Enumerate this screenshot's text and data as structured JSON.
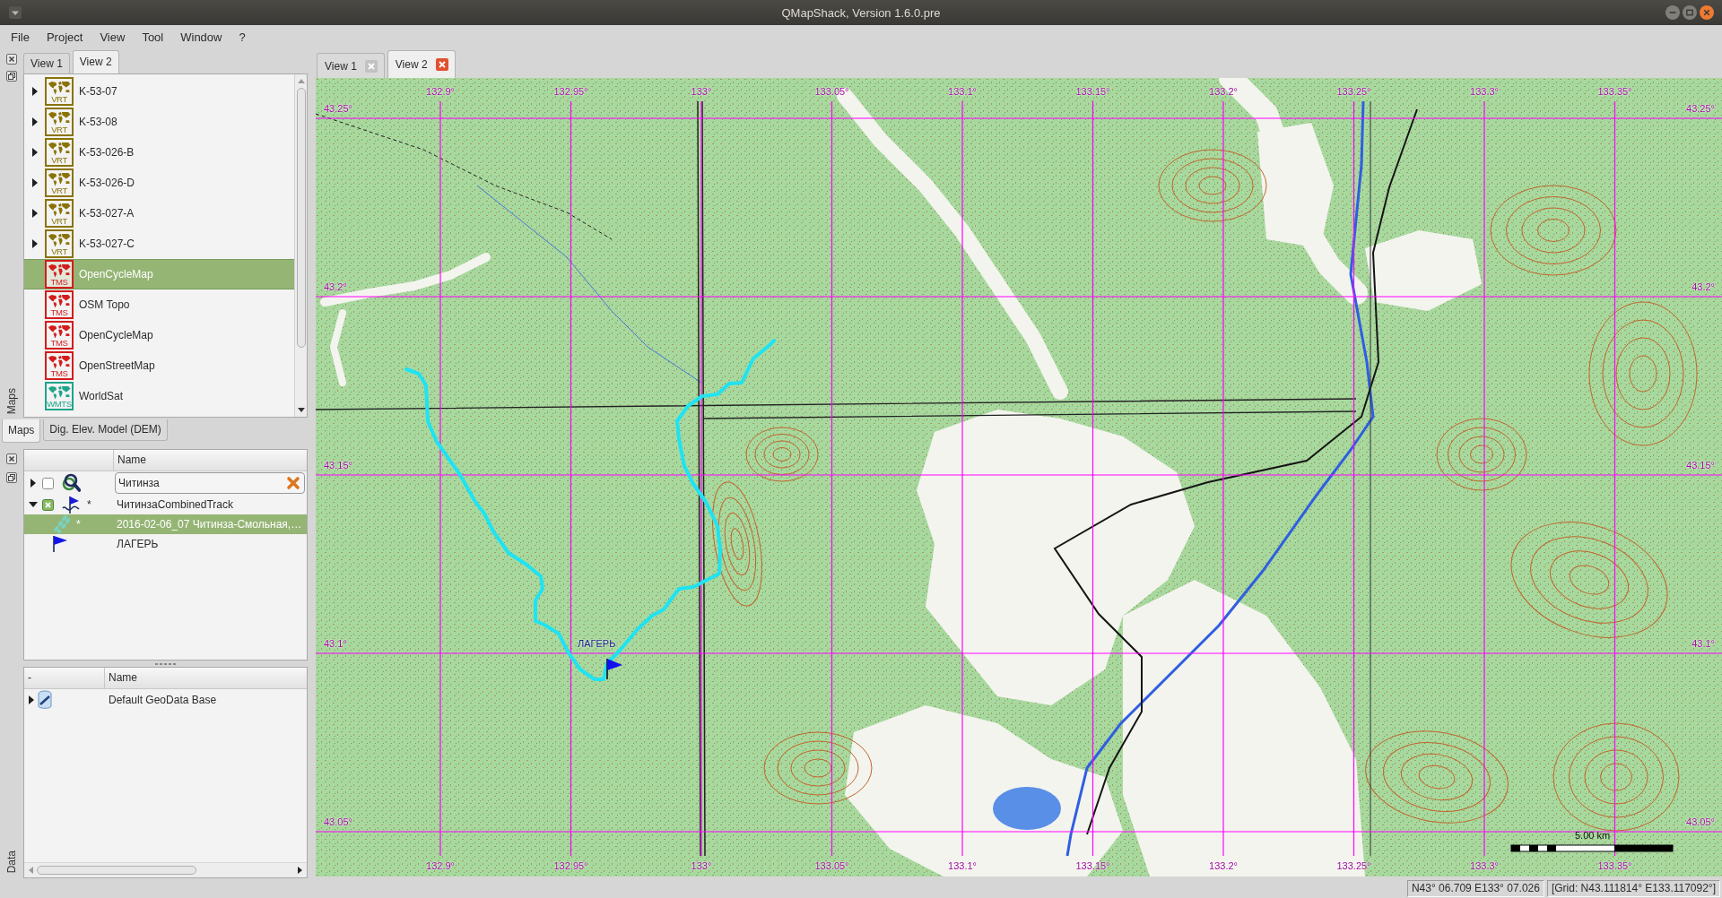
{
  "window": {
    "title": "QMapShack, Version 1.6.0.pre"
  },
  "menu": [
    "File",
    "Project",
    "View",
    "Tool",
    "Window",
    "?"
  ],
  "maps_dock": {
    "title": "Maps",
    "view_tabs": [
      {
        "label": "View 1",
        "selected": false
      },
      {
        "label": "View 2",
        "selected": true
      }
    ],
    "maps": [
      {
        "name": "K-53-07",
        "type": "VRT",
        "color": "#8a7305",
        "expandable": true,
        "selected": false
      },
      {
        "name": "K-53-08",
        "type": "VRT",
        "color": "#8a7305",
        "expandable": true,
        "selected": false
      },
      {
        "name": "K-53-026-B",
        "type": "VRT",
        "color": "#8a7305",
        "expandable": true,
        "selected": false
      },
      {
        "name": "K-53-026-D",
        "type": "VRT",
        "color": "#8a7305",
        "expandable": true,
        "selected": false
      },
      {
        "name": "K-53-027-A",
        "type": "VRT",
        "color": "#8a7305",
        "expandable": true,
        "selected": false
      },
      {
        "name": "K-53-027-C",
        "type": "VRT",
        "color": "#8a7305",
        "expandable": true,
        "selected": false
      },
      {
        "name": "OpenCycleMap",
        "type": "TMS",
        "color": "#d41c1c",
        "expandable": false,
        "selected": true
      },
      {
        "name": "OSM Topo",
        "type": "TMS",
        "color": "#d41c1c",
        "expandable": false,
        "selected": false
      },
      {
        "name": "OpenCycleMap",
        "type": "TMS",
        "color": "#d41c1c",
        "expandable": false,
        "selected": false
      },
      {
        "name": "OpenStreetMap",
        "type": "TMS",
        "color": "#d41c1c",
        "expandable": false,
        "selected": false
      },
      {
        "name": "WorldSat",
        "type": "WMTS",
        "color": "#1fa58a",
        "expandable": false,
        "selected": false
      }
    ]
  },
  "dock_tabs": [
    {
      "label": "Maps",
      "selected": true
    },
    {
      "label": "Dig. Elev. Model (DEM)",
      "selected": false
    }
  ],
  "data_dock": {
    "title": "Data",
    "workspace": {
      "column": "Name",
      "items": [
        {
          "kind": "project",
          "name": "Читинза",
          "expanded": false,
          "checked": false,
          "editing": true,
          "selected": false
        },
        {
          "kind": "gpx",
          "name": "ЧитинзаCombinedTrack",
          "mark": "*",
          "expanded": true,
          "checked": true,
          "editing": false,
          "selected": false,
          "children": [
            {
              "kind": "track",
              "name": "2016-02-06_07 Читинза-Смольная,…",
              "mark": "*",
              "selected": true
            },
            {
              "kind": "waypoint",
              "name": "ЛАГЕРЬ",
              "selected": false
            }
          ]
        }
      ]
    },
    "database": {
      "columns": [
        "-",
        "Name"
      ],
      "items": [
        {
          "name": "Default GeoData Base",
          "expanded": false
        }
      ]
    }
  },
  "map_view": {
    "tabs": [
      {
        "label": "View 1",
        "selected": false
      },
      {
        "label": "View 2",
        "selected": true
      }
    ],
    "grid": {
      "top": [
        "132.9°",
        "132.95°",
        "133°",
        "133.05°",
        "133.1°",
        "133.15°",
        "133.2°",
        "133.25°",
        "133.3°",
        "133.35°"
      ],
      "bottom": [
        "132.9°",
        "132.95°",
        "133°",
        "133.05°",
        "133.1°",
        "133.15°",
        "133.2°",
        "133.25°",
        "133.3°",
        "133.35°"
      ],
      "left": [
        "43.25°",
        "43.2°",
        "43.15°",
        "43.1°",
        "43.05°"
      ],
      "right": [
        "43.25°",
        "43.2°",
        "43.15°",
        "43.1°",
        "43.05°"
      ]
    },
    "waypoint": {
      "label": "ЛАГЕРЬ"
    },
    "scale": {
      "label": "5.00 km"
    }
  },
  "status_bar": {
    "position": "N43° 06.709 E133° 07.026",
    "grid": "[Grid: N43.111814° E133.117092°]"
  }
}
